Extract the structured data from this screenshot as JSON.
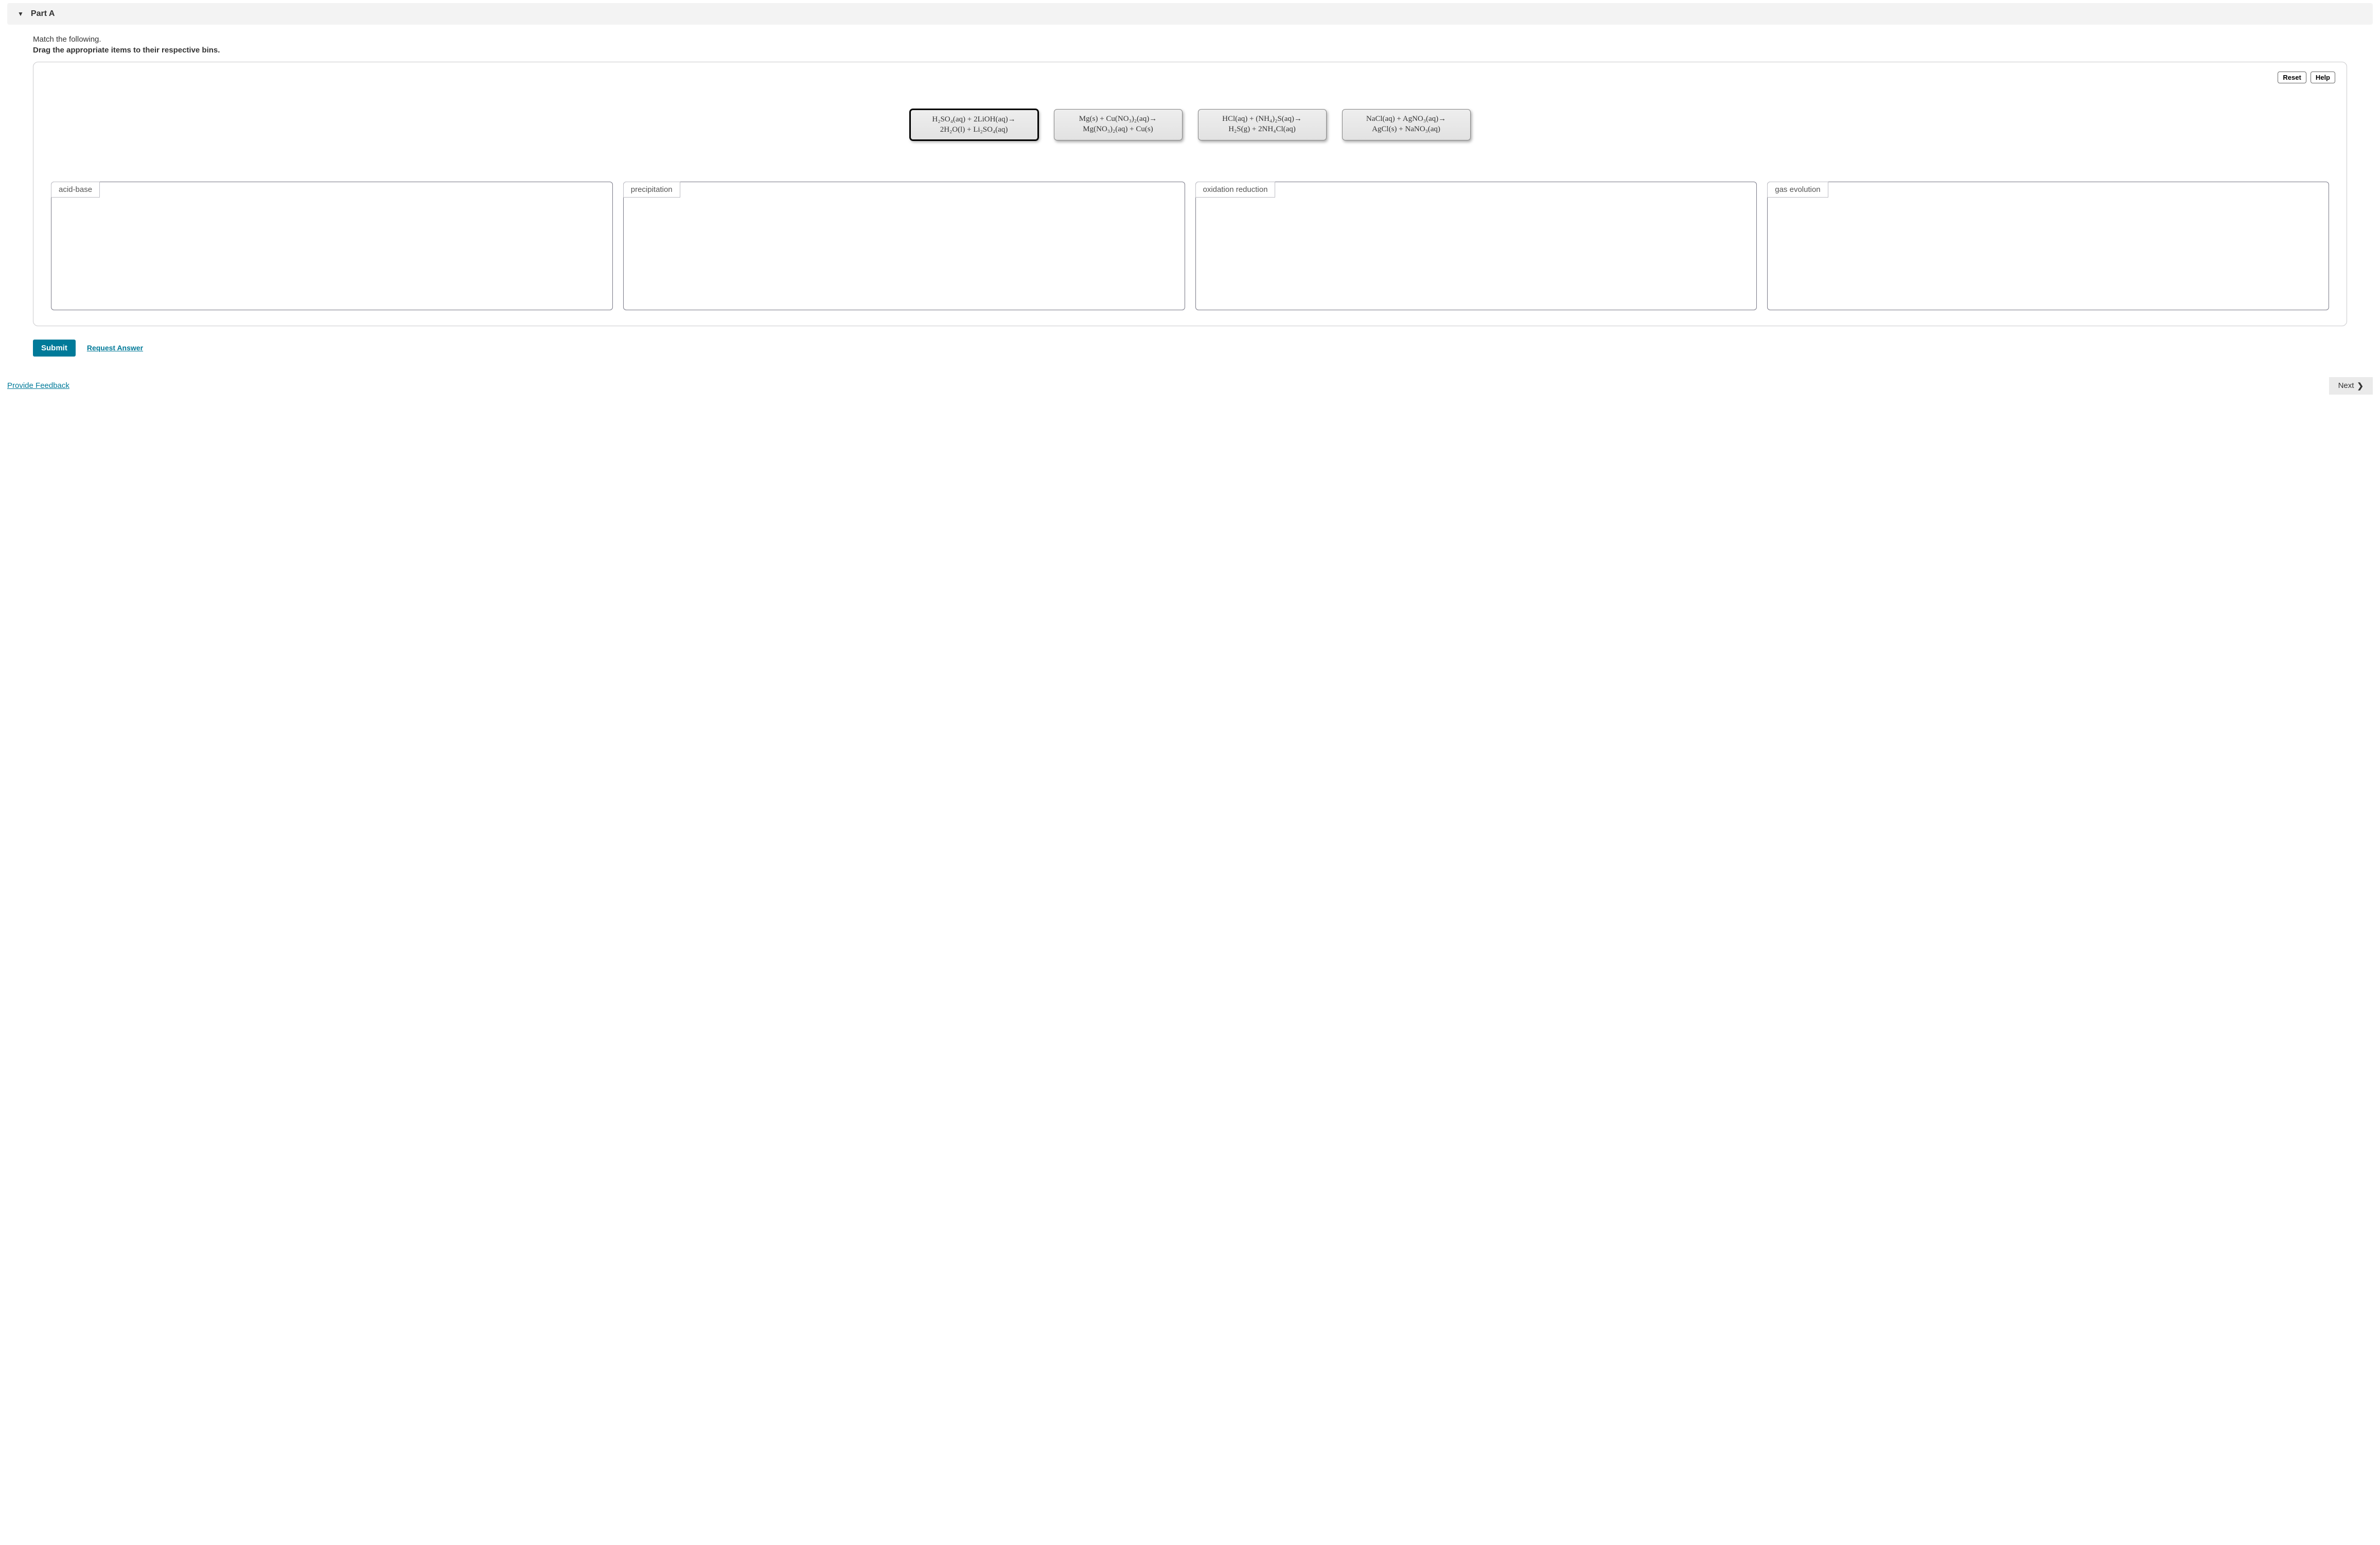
{
  "header": {
    "title": "Part A"
  },
  "instructions": {
    "line1": "Match the following.",
    "line2": "Drag the appropriate items to their respective bins."
  },
  "toolbar": {
    "reset_label": "Reset",
    "help_label": "Help"
  },
  "tiles": [
    {
      "selected": true,
      "reactants": "H₂SO₄(aq) + 2LiOH(aq)→",
      "products": "2H₂O(l) + Li₂SO₄(aq)",
      "formula_plain": "H2SO4(aq) + 2LiOH(aq) -> 2H2O(l) + Li2SO4(aq)"
    },
    {
      "selected": false,
      "reactants": "Mg(s) + Cu(NO₃)₂(aq)→",
      "products": "Mg(NO₃)₂(aq) + Cu(s)",
      "formula_plain": "Mg(s) + Cu(NO3)2(aq) -> Mg(NO3)2(aq) + Cu(s)"
    },
    {
      "selected": false,
      "reactants": "HCl(aq) + (NH₄)₂S(aq)→",
      "products": "H₂S(g) + 2NH₄Cl(aq)",
      "formula_plain": "HCl(aq) + (NH4)2S(aq) -> H2S(g) + 2NH4Cl(aq)"
    },
    {
      "selected": false,
      "reactants": "NaCl(aq) + AgNO₃(aq)→",
      "products": "AgCl(s) + NaNO₃(aq)",
      "formula_plain": "NaCl(aq) + AgNO3(aq) -> AgCl(s) + NaNO3(aq)"
    }
  ],
  "bins": [
    {
      "label": "acid-base"
    },
    {
      "label": "precipitation"
    },
    {
      "label": "oxidation reduction"
    },
    {
      "label": "gas evolution"
    }
  ],
  "actions": {
    "submit_label": "Submit",
    "request_label": "Request Answer"
  },
  "footer": {
    "feedback_label": "Provide Feedback",
    "next_label": "Next"
  }
}
